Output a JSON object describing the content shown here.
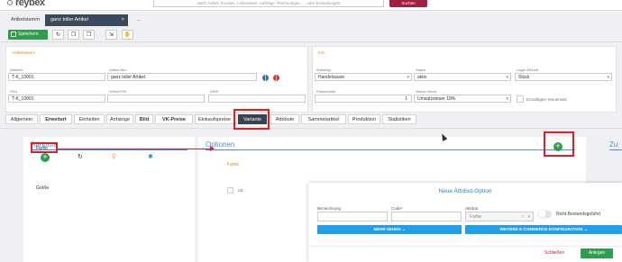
{
  "topbar": {
    "logo": "reybex",
    "search_placeholder": "Nach Artikel, Kunden, Lieferanten, Aufträge, Rechnungen, ... oder Einstellungen",
    "search_button": "Suchen"
  },
  "doc_tabs": [
    {
      "label": "Artikelstamm"
    },
    {
      "label": "ganz toller Artikel",
      "close": "×"
    },
    {
      "label": "..."
    }
  ],
  "toolbar": {
    "save_label": "Speichern",
    "icons": [
      "refresh-icon",
      "copy-icon",
      "copy-icon",
      "export-icon",
      "hand-icon"
    ]
  },
  "artikelstamm": {
    "title": "Artikelstamm",
    "fields": {
      "artikel_nr": {
        "label": "Artikelnr",
        "value": "T-K_10001"
      },
      "artikel_bez": {
        "label": "Artikel-Bez.",
        "value": "ganz toller Artikel"
      },
      "sku": {
        "label": "SKU",
        "value": "T-K_10001"
      },
      "gan_ean": {
        "label": "GAN/GTIN",
        "value": ""
      },
      "asin": {
        "label": "ASIN",
        "value": ""
      }
    }
  },
  "info": {
    "title": "Info",
    "fields": {
      "artikeltyp": {
        "label": "Artikeltyp",
        "value": "Handelsware"
      },
      "status": {
        "label": "Status",
        "value": "aktiv"
      },
      "lager_einheit": {
        "label": "Lager-Einheit",
        "value": "Stück"
      },
      "preiseinheit": {
        "label": "Preiseinheit",
        "value": "1"
      },
      "steuer_intern": {
        "label": "Steuer Intern",
        "value": "Umsatzsteuer 19%"
      },
      "ermaessigter": {
        "label": "Ermäßigter Steuersatz"
      }
    }
  },
  "section_tabs": [
    "Allgemein",
    "Erweitert",
    "Einheiten",
    "Anhänge",
    "Bild",
    "VK-Preise",
    "Einkaufspreise",
    "Variante",
    "Attribute",
    "Sammelartikel",
    "Produktion",
    "Statistiken"
  ],
  "attribute": {
    "title": "Attribute",
    "items": [
      "Farbe",
      "Größe"
    ]
  },
  "optionen": {
    "title": "Optionen",
    "subtitle": "Farbe",
    "item": "rot"
  },
  "third_title": "Zu",
  "modal": {
    "title": "Neue Attribut-Option",
    "bezeichnung_label": "Bezeichnung",
    "code_label": "Code*",
    "attribut_label": "Attribut",
    "attribut_value": "Farbe",
    "toggle_label": "Nicht Bestandsgeführt",
    "mehr_sehen": "MEHR SEHEN",
    "weitere": "WEITERE E-COMMERCE-KONFIGURATION",
    "close": "Schließen",
    "save": "Anlegen"
  },
  "colors": {
    "accent": "#2e9e4e",
    "blue": "#21a0e8",
    "highlight": "#e02020",
    "title_orange": "#e08a1e"
  }
}
